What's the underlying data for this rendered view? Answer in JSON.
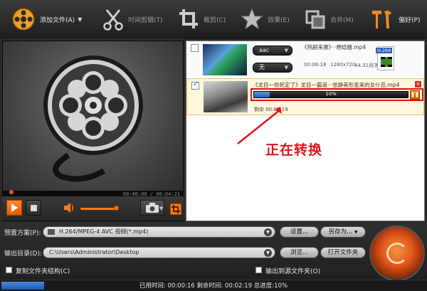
{
  "toolbar": {
    "add_file": "添加文件(A)",
    "trim": "时间剪辑(T)",
    "crop": "裁剪(C)",
    "effect": "效果(E)",
    "merge": "合并(M)",
    "prefs": "偏好(P)"
  },
  "player": {
    "time": "00:00:00 / 00:04:21"
  },
  "files": [
    {
      "name": "《热剧来袭》···想结婚.mp4",
      "audio": "aac",
      "subtitle": "无",
      "duration": "00:06:18",
      "resolution": "1280x720",
      "size": "44.31兆字节",
      "format_badge": "H.264",
      "checked": false
    },
    {
      "name": "《龙目一你死定了》龙目一霸道···张静美形变来的女仆范.mp4",
      "progress_label": "10%",
      "progress": 0.1,
      "remaining": "剩余 00:02:19",
      "checked": true
    }
  ],
  "annotation": "正在转换",
  "settings": {
    "preset_label": "预置方案(P):",
    "preset_value": "H.264/MPEG-4 AVC 视频(*.mp4)",
    "settings_btn": "设置...",
    "save_as_btn": "另存为...",
    "output_label": "输出目录(D):",
    "output_value": "C:\\Users\\Administrator\\Desktop",
    "browse_btn": "浏览...",
    "open_folder_btn": "打开文件夹",
    "copy_structure": "复制文件夹结构(C)",
    "output_to_source": "输出到源文件夹(O)"
  },
  "status": {
    "text": "已用时间: 00:00:16  剩余时间: 00:02:19  总进度:10%",
    "progress": 0.1
  },
  "colors": {
    "accent": "#ff7a1a",
    "progress": "#2b6fd0",
    "annotation": "#e0161a"
  }
}
